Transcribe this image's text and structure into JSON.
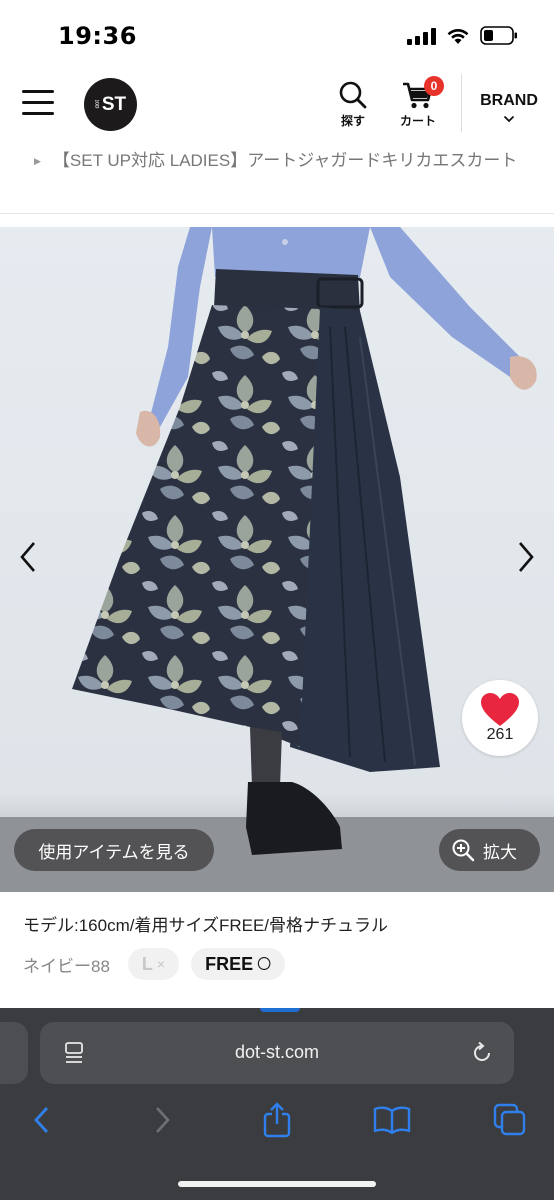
{
  "status_bar": {
    "time": "19:36",
    "icons": [
      "cellular-signal-icon",
      "wifi-icon",
      "battery-icon"
    ]
  },
  "header": {
    "logo_text": "ST",
    "logo_small_text": "dot",
    "search_label": "探す",
    "cart_label": "カート",
    "cart_count": "0",
    "brand_label": "BRAND",
    "colors": {
      "badge": "#e8332a",
      "logo_bg": "#1c1a1a"
    }
  },
  "breadcrumb": {
    "product_title": "【SET UP対応 LADIES】アートジャガードキリカエスカート"
  },
  "product_image": {
    "like_count": "261",
    "view_items_label": "使用アイテムを見る",
    "zoom_label": "拡大",
    "colors": {
      "like_heart": "#e8263f"
    }
  },
  "product_info": {
    "model_info": "モデル:160cm/着用サイズFREE/骨格ナチュラル",
    "color_name": "ネイビー88",
    "sizes": [
      {
        "label": "L",
        "mark": "×"
      },
      {
        "label": "FREE",
        "mark": "〇"
      }
    ]
  },
  "browser": {
    "url": "dot-st.com",
    "colors": {
      "accent": "#2f80ed",
      "toolbar_bg": "#3b3c3f"
    }
  }
}
